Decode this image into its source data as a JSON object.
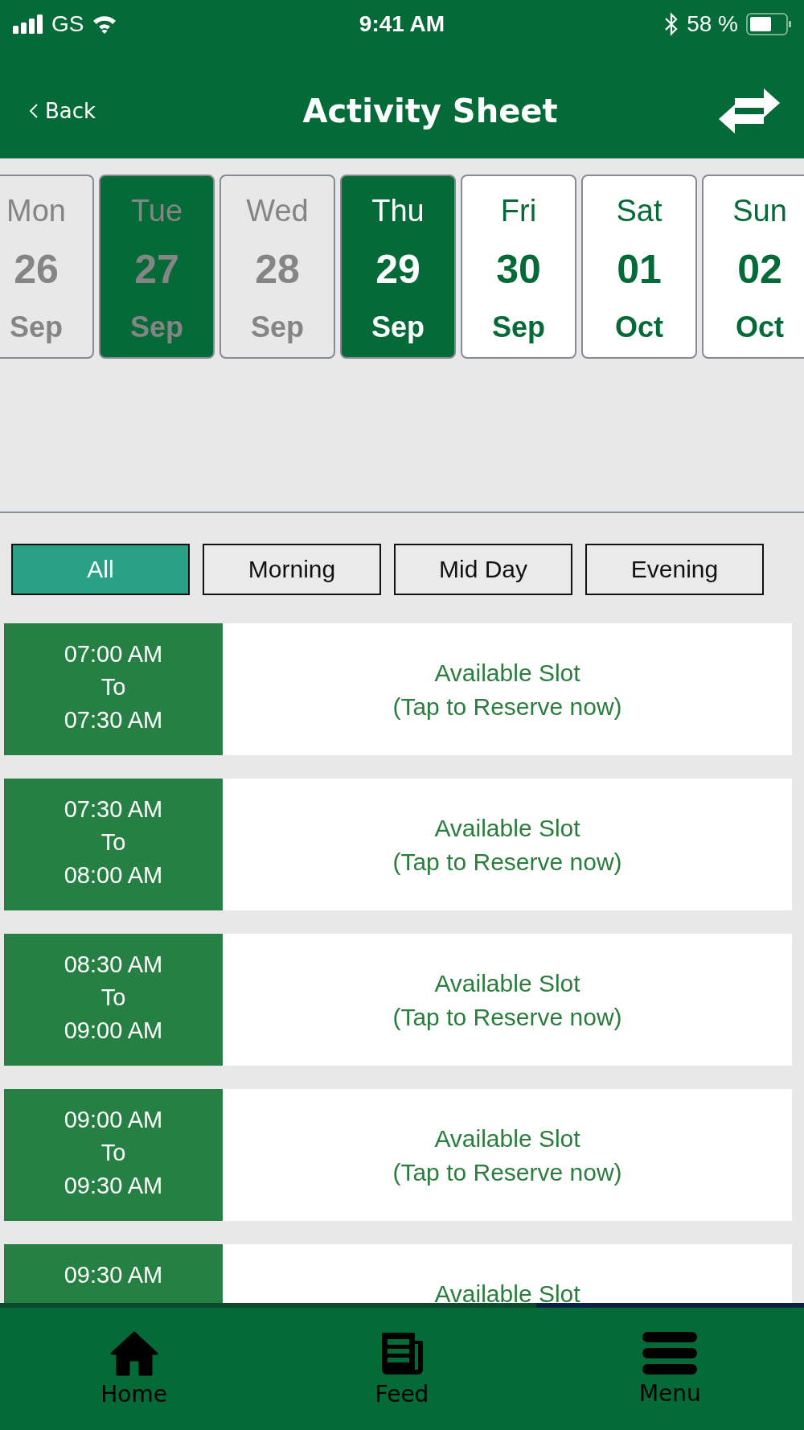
{
  "status_bar": {
    "carrier": "GS",
    "time": "9:41 AM",
    "battery": "58 %"
  },
  "header": {
    "back_label": "Back",
    "title": "Activity Sheet"
  },
  "dates": [
    {
      "weekday": "Mon",
      "day": "26",
      "month": "Sep",
      "past": true,
      "marked": false,
      "selected": false
    },
    {
      "weekday": "Tue",
      "day": "27",
      "month": "Sep",
      "past": true,
      "marked": true,
      "selected": false
    },
    {
      "weekday": "Wed",
      "day": "28",
      "month": "Sep",
      "past": true,
      "marked": false,
      "selected": false
    },
    {
      "weekday": "Thu",
      "day": "29",
      "month": "Sep",
      "past": false,
      "marked": true,
      "selected": true
    },
    {
      "weekday": "Fri",
      "day": "30",
      "month": "Sep",
      "past": false,
      "marked": false,
      "selected": false
    },
    {
      "weekday": "Sat",
      "day": "01",
      "month": "Oct",
      "past": false,
      "marked": false,
      "selected": false
    },
    {
      "weekday": "Sun",
      "day": "02",
      "month": "Oct",
      "past": false,
      "marked": false,
      "selected": false
    }
  ],
  "filters": [
    {
      "label": "All",
      "selected": true
    },
    {
      "label": "Morning",
      "selected": false
    },
    {
      "label": "Mid Day",
      "selected": false
    },
    {
      "label": "Evening",
      "selected": false
    }
  ],
  "slots": [
    {
      "start": "07:00 AM",
      "separator": "To",
      "end": "07:30 AM",
      "status": "Available Slot",
      "action": "(Tap to Reserve now)"
    },
    {
      "start": "07:30 AM",
      "separator": "To",
      "end": "08:00 AM",
      "status": "Available Slot",
      "action": "(Tap to Reserve now)"
    },
    {
      "start": "08:30 AM",
      "separator": "To",
      "end": "09:00 AM",
      "status": "Available Slot",
      "action": "(Tap to Reserve now)"
    },
    {
      "start": "09:00 AM",
      "separator": "To",
      "end": "09:30 AM",
      "status": "Available Slot",
      "action": "(Tap to Reserve now)"
    },
    {
      "start": "09:30 AM",
      "status": "Available Slot"
    }
  ],
  "nav": [
    {
      "kind": "home",
      "label": "Home"
    },
    {
      "kind": "feed",
      "label": "Feed"
    },
    {
      "kind": "menu",
      "label": "Menu"
    }
  ]
}
